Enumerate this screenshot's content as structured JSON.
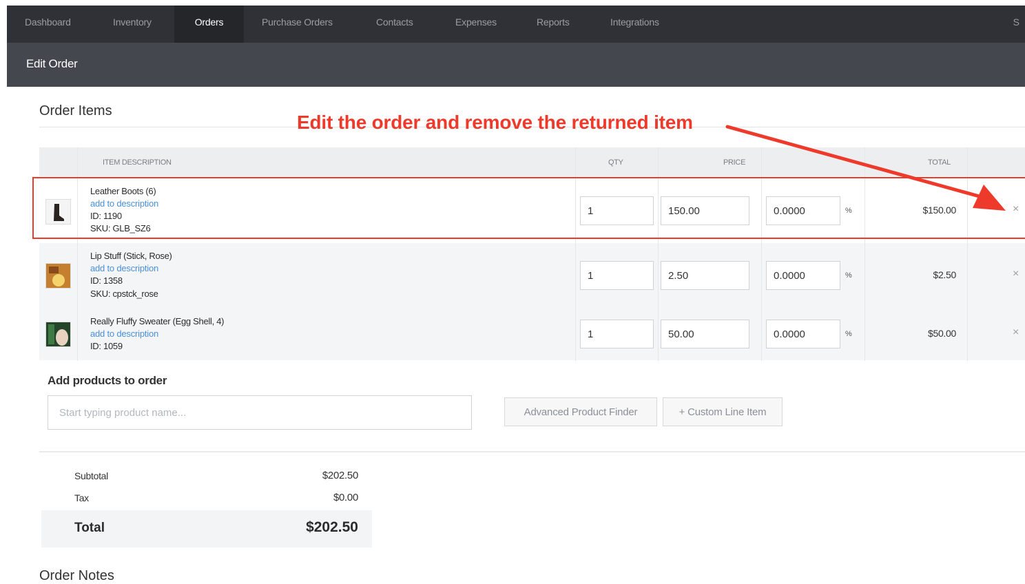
{
  "nav": {
    "items": [
      "Dashboard",
      "Inventory",
      "Orders",
      "Purchase Orders",
      "Contacts",
      "Expenses",
      "Reports",
      "Integrations"
    ],
    "active": "Orders",
    "end": "S"
  },
  "subbar": {
    "title": "Edit Order"
  },
  "order_items": {
    "title": "Order Items",
    "headers": {
      "description": "ITEM DESCRIPTION",
      "qty": "QTY",
      "price": "PRICE",
      "total": "TOTAL"
    },
    "rows": [
      {
        "name": "Leather Boots (6)",
        "link": "add to description",
        "id": "ID: 1190",
        "sku": "SKU: GLB_SZ6",
        "qty": "1",
        "price": "150.00",
        "discount": "0.0000",
        "pct": "%",
        "total": "$150.00",
        "remove": "×"
      },
      {
        "name": "Lip Stuff (Stick, Rose)",
        "link": "add to description",
        "id": "ID: 1358",
        "sku": "SKU: cpstck_rose",
        "qty": "1",
        "price": "2.50",
        "discount": "0.0000",
        "pct": "%",
        "total": "$2.50",
        "remove": "×"
      },
      {
        "name": "Really Fluffy Sweater (Egg Shell, 4)",
        "link": "add to description",
        "id": "ID: 1059",
        "sku": "",
        "qty": "1",
        "price": "50.00",
        "discount": "0.0000",
        "pct": "%",
        "total": "$50.00",
        "remove": "×"
      }
    ]
  },
  "annotation": {
    "text": "Edit the order and remove the returned item",
    "color": "#ee3a2b"
  },
  "add_products": {
    "title": "Add products to order",
    "placeholder": "Start typing product name...",
    "finder_button": "Advanced Product Finder",
    "custom_button": "+ Custom Line Item"
  },
  "summary": {
    "subtotal_label": "Subtotal",
    "subtotal": "$202.50",
    "tax_label": "Tax",
    "tax": "$0.00",
    "total_label": "Total",
    "total": "$202.50"
  },
  "notes": {
    "title": "Order Notes"
  }
}
